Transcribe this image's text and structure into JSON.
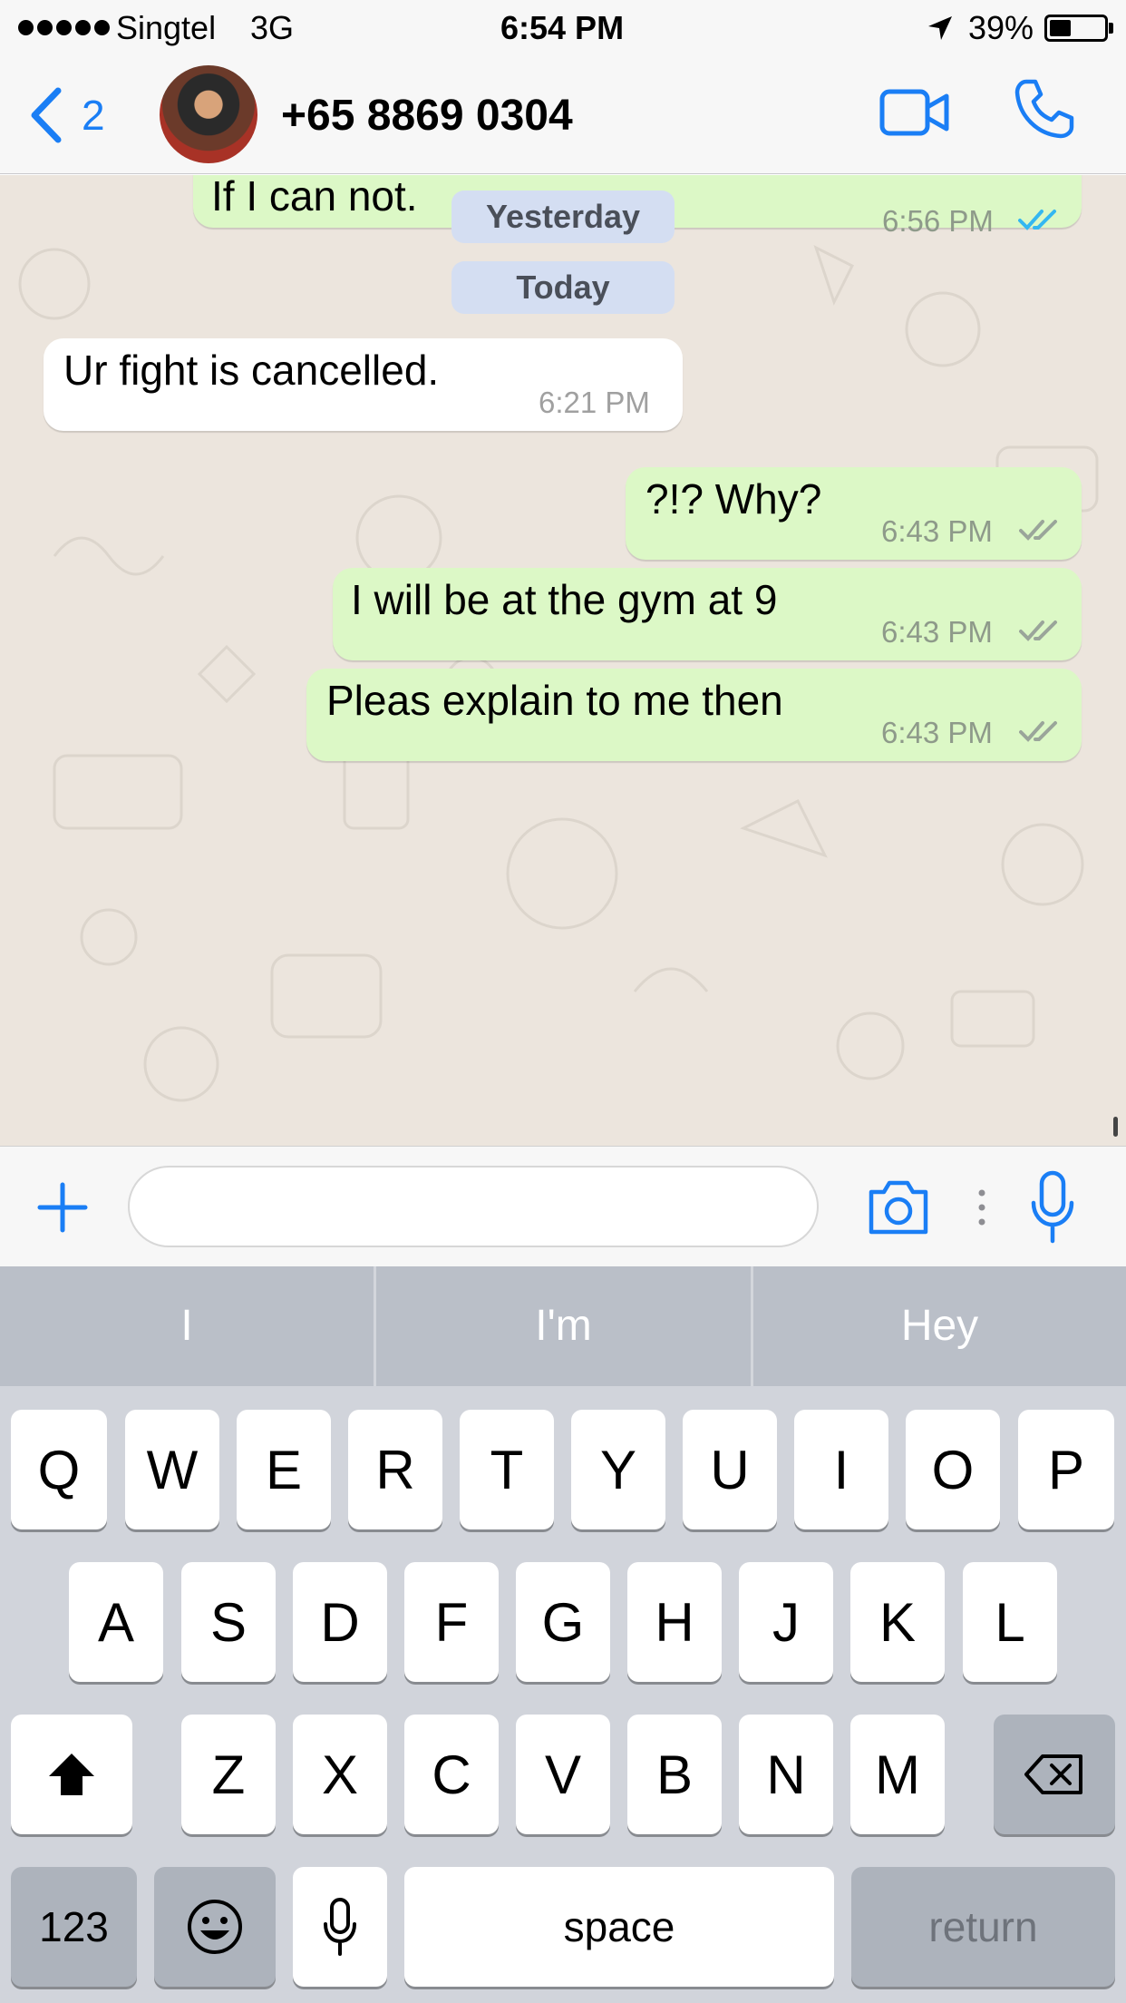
{
  "status_bar": {
    "carrier": "Singtel",
    "network": "3G",
    "time": "6:54 PM",
    "battery": "39%",
    "battery_level": 0.39
  },
  "nav": {
    "back_count": "2",
    "contact_name": "+65 8869 0304"
  },
  "chat": {
    "partial_message": {
      "text": "If I can not.",
      "time": "6:56 PM"
    },
    "date_yesterday": "Yesterday",
    "date_today": "Today",
    "messages": [
      {
        "direction": "incoming",
        "text": "Ur fight is cancelled.",
        "time": "6:21 PM"
      },
      {
        "direction": "outgoing",
        "text": "?!? Why?",
        "time": "6:43 PM"
      },
      {
        "direction": "outgoing",
        "text": "I will be at the gym at 9",
        "time": "6:43 PM"
      },
      {
        "direction": "outgoing",
        "text": "Pleas explain to me then",
        "time": "6:43 PM"
      }
    ]
  },
  "input": {
    "value": "",
    "placeholder": ""
  },
  "keyboard": {
    "predictions": [
      "I",
      "I'm",
      "Hey"
    ],
    "row1": [
      "Q",
      "W",
      "E",
      "R",
      "T",
      "Y",
      "U",
      "I",
      "O",
      "P"
    ],
    "row2": [
      "A",
      "S",
      "D",
      "F",
      "G",
      "H",
      "J",
      "K",
      "L"
    ],
    "row3": [
      "Z",
      "X",
      "C",
      "V",
      "B",
      "N",
      "M"
    ],
    "numbers_label": "123",
    "space_label": "space",
    "return_label": "return"
  },
  "colors": {
    "accent": "#1a7ef5",
    "outgoing_bubble": "#dcf8c6",
    "incoming_bubble": "#ffffff",
    "chat_background": "#ece5dd",
    "read_ticks": "#34b7f1",
    "delivered_ticks": "#9aa59a"
  },
  "icons": [
    "chevron-left-icon",
    "video-camera-icon",
    "phone-icon",
    "plus-icon",
    "camera-icon",
    "microphone-icon",
    "shift-icon",
    "delete-icon",
    "emoji-icon",
    "location-arrow-icon"
  ]
}
